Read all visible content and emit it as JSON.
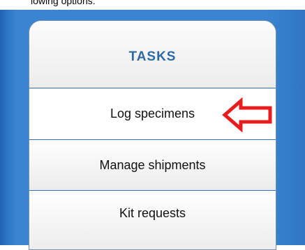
{
  "top_text": "lowing options:",
  "panel": {
    "title": "TASKS",
    "items": [
      {
        "label": "Log specimens",
        "active": true
      },
      {
        "label": "Manage shipments",
        "active": false
      },
      {
        "label": "Kit requests",
        "active": false
      }
    ]
  },
  "annotation": {
    "arrow_icon": "left-arrow-icon",
    "arrow_color": "#e81c1c"
  },
  "colors": {
    "background_blue": "#3a84d2",
    "title_blue": "#2d6aa3",
    "divider_blue": "#2f6fb4"
  }
}
